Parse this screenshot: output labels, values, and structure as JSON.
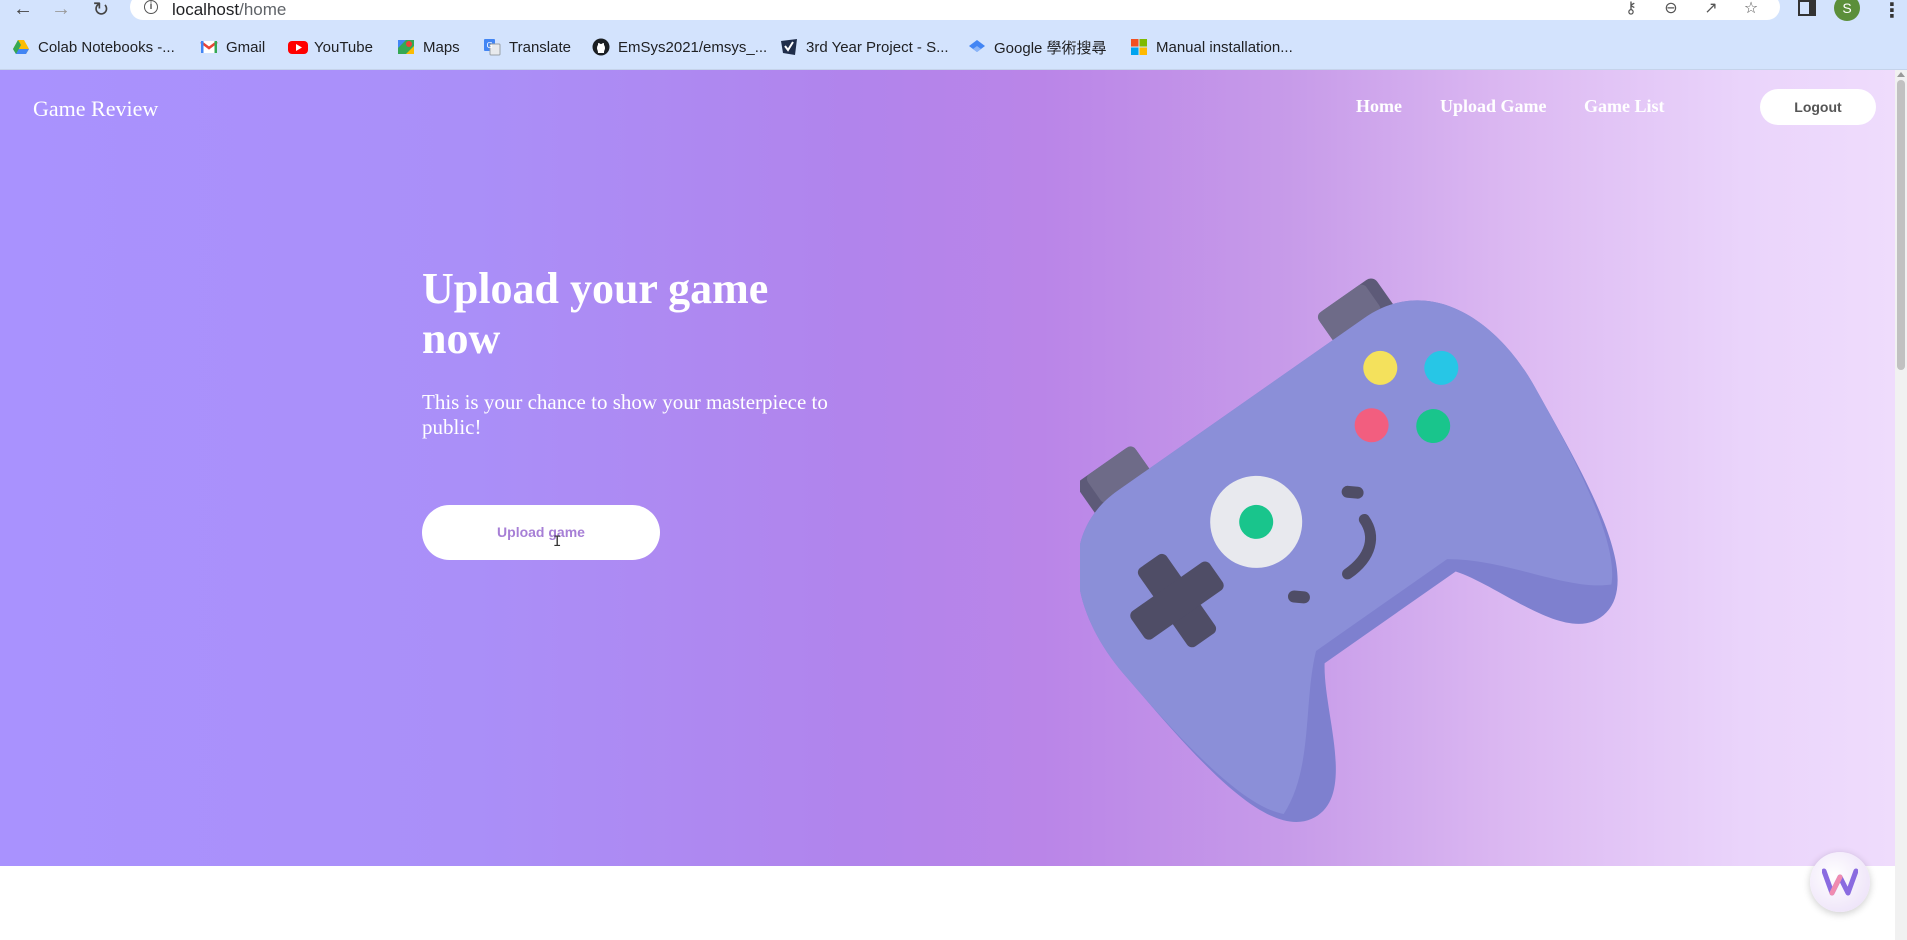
{
  "browser": {
    "url_host": "localhost",
    "url_path": "/home",
    "profile_initial": "S",
    "bookmarks": [
      {
        "label": "Colab Notebooks -...",
        "icon": "drive-icon"
      },
      {
        "label": "Gmail",
        "icon": "gmail-icon"
      },
      {
        "label": "YouTube",
        "icon": "youtube-icon"
      },
      {
        "label": "Maps",
        "icon": "maps-icon"
      },
      {
        "label": "Translate",
        "icon": "translate-icon"
      },
      {
        "label": "EmSys2021/emsys_...",
        "icon": "github-icon"
      },
      {
        "label": "3rd Year Project - S...",
        "icon": "project-icon"
      },
      {
        "label": "Google 學術搜尋",
        "icon": "scholar-icon"
      },
      {
        "label": "Manual installation...",
        "icon": "microsoft-icon"
      }
    ]
  },
  "navbar": {
    "brand": "Game Review",
    "links": [
      "Home",
      "Upload Game",
      "Game List"
    ],
    "logout_label": "Logout"
  },
  "hero": {
    "title": "Upload your game now",
    "subtitle": "This is your chance to show your masterpiece to public!",
    "button_label": "Upload game"
  },
  "colors": {
    "gradient_start": "#a992fe",
    "gradient_mid": "#b184ec",
    "gradient_end": "#efdcfc",
    "gamepad_body": "#8b8fd8",
    "button_text": "#a77fd6"
  }
}
